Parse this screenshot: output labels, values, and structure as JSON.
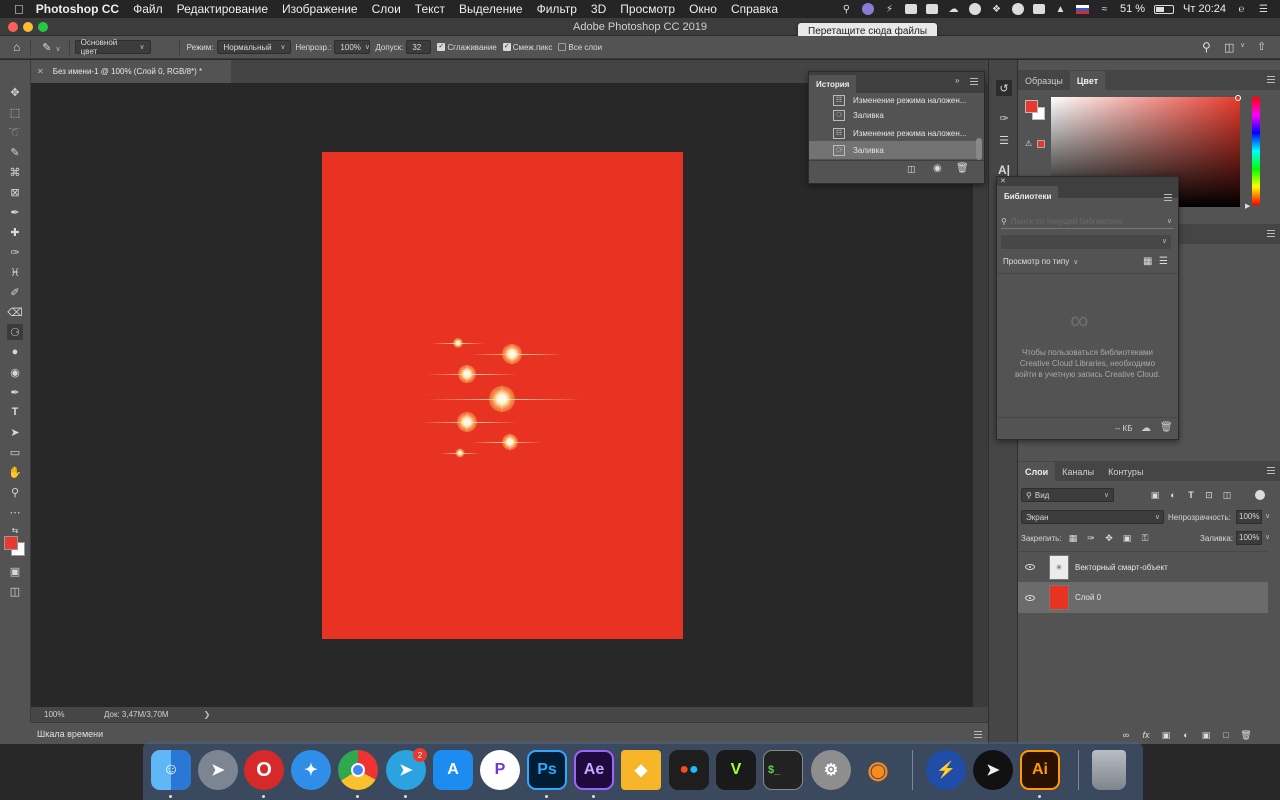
{
  "menubar": {
    "app_name": "Photoshop CC",
    "items": [
      "Файл",
      "Редактирование",
      "Изображение",
      "Слои",
      "Текст",
      "Выделение",
      "Фильтр",
      "3D",
      "Просмотр",
      "Окно",
      "Справка"
    ],
    "battery": "51 %",
    "clock": "Чт 20:24"
  },
  "window": {
    "title": "Adobe Photoshop CC 2019",
    "tooltip": "Перетащите сюда файлы"
  },
  "options": {
    "fill_source": "Основной цвет",
    "mode_label": "Режим:",
    "mode_value": "Нормальный",
    "opacity_label": "Непрозр.:",
    "opacity_value": "100%",
    "tolerance_label": "Допуск:",
    "tolerance_value": "32",
    "antialias_label": "Сглаживание",
    "antialias_checked": true,
    "contiguous_label": "Смеж.пикс",
    "contiguous_checked": true,
    "all_layers_label": "Все слои",
    "all_layers_checked": false
  },
  "document": {
    "tab_title": "Без имени-1 @ 100% (Слой 0, RGB/8*) *",
    "zoom": "100%",
    "doc_size": "Док: 3,47M/3,70M",
    "artboard_color": "#e83323"
  },
  "timeline": {
    "label": "Шкала времени"
  },
  "history": {
    "title": "История",
    "items": [
      {
        "label": "Изменение режима наложен..."
      },
      {
        "label": "Заливка"
      },
      {
        "label": "Изменение режима наложен..."
      },
      {
        "label": "Заливка"
      }
    ],
    "active_index": 3
  },
  "color_panel": {
    "tabs": [
      "Образцы",
      "Цвет"
    ],
    "active_tab": "Цвет",
    "foreground": "#e8392e",
    "background": "#ffffff"
  },
  "libraries": {
    "title": "Библиотеки",
    "search_placeholder": "Поиск по текущей библиотеке",
    "view_by": "Просмотр по типу",
    "empty_message": "Чтобы пользоваться библиотеками Creative Cloud Libraries, необходимо войти в учетную запись Creative Cloud.",
    "size": "-- КБ"
  },
  "layers": {
    "tabs": [
      "Слои",
      "Каналы",
      "Контуры"
    ],
    "active_tab": "Слои",
    "filter_kind": "Вид",
    "blend_mode": "Экран",
    "opacity_label": "Непрозрачность:",
    "opacity_value": "100%",
    "lock_label": "Закрепить:",
    "fill_label": "Заливка:",
    "fill_value": "100%",
    "items": [
      {
        "name": "Векторный смарт-объект",
        "visible": true,
        "thumb": "smart-object",
        "selected": false
      },
      {
        "name": "Слой 0",
        "visible": true,
        "thumb": "#e83323",
        "selected": true
      }
    ]
  },
  "dock": {
    "apps": [
      "Finder",
      "Launchpad",
      "Opera",
      "Safari",
      "Chrome",
      "Telegram",
      "App Store",
      "Pockity",
      "Ps",
      "Ae",
      "Sketch",
      "Figma",
      "Vectorize",
      "Terminal",
      "System Preferences",
      "Blender",
      "Reeder",
      "Tor",
      "Ai",
      "Trash"
    ],
    "telegram_badge": "2"
  }
}
